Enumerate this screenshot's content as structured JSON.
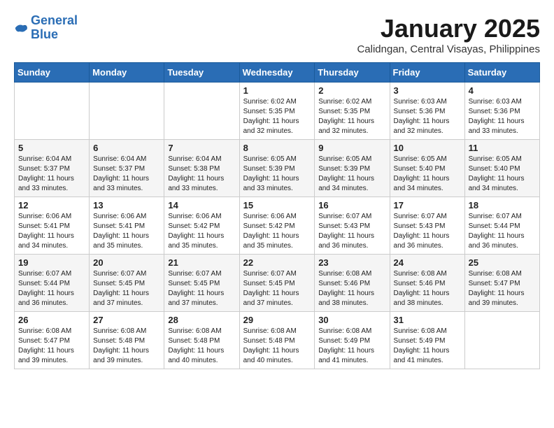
{
  "logo": {
    "line1": "General",
    "line2": "Blue"
  },
  "title": "January 2025",
  "location": "Calidngan, Central Visayas, Philippines",
  "days_of_week": [
    "Sunday",
    "Monday",
    "Tuesday",
    "Wednesday",
    "Thursday",
    "Friday",
    "Saturday"
  ],
  "weeks": [
    [
      {
        "num": "",
        "sunrise": "",
        "sunset": "",
        "daylight": ""
      },
      {
        "num": "",
        "sunrise": "",
        "sunset": "",
        "daylight": ""
      },
      {
        "num": "",
        "sunrise": "",
        "sunset": "",
        "daylight": ""
      },
      {
        "num": "1",
        "sunrise": "Sunrise: 6:02 AM",
        "sunset": "Sunset: 5:35 PM",
        "daylight": "Daylight: 11 hours and 32 minutes."
      },
      {
        "num": "2",
        "sunrise": "Sunrise: 6:02 AM",
        "sunset": "Sunset: 5:35 PM",
        "daylight": "Daylight: 11 hours and 32 minutes."
      },
      {
        "num": "3",
        "sunrise": "Sunrise: 6:03 AM",
        "sunset": "Sunset: 5:36 PM",
        "daylight": "Daylight: 11 hours and 32 minutes."
      },
      {
        "num": "4",
        "sunrise": "Sunrise: 6:03 AM",
        "sunset": "Sunset: 5:36 PM",
        "daylight": "Daylight: 11 hours and 33 minutes."
      }
    ],
    [
      {
        "num": "5",
        "sunrise": "Sunrise: 6:04 AM",
        "sunset": "Sunset: 5:37 PM",
        "daylight": "Daylight: 11 hours and 33 minutes."
      },
      {
        "num": "6",
        "sunrise": "Sunrise: 6:04 AM",
        "sunset": "Sunset: 5:37 PM",
        "daylight": "Daylight: 11 hours and 33 minutes."
      },
      {
        "num": "7",
        "sunrise": "Sunrise: 6:04 AM",
        "sunset": "Sunset: 5:38 PM",
        "daylight": "Daylight: 11 hours and 33 minutes."
      },
      {
        "num": "8",
        "sunrise": "Sunrise: 6:05 AM",
        "sunset": "Sunset: 5:39 PM",
        "daylight": "Daylight: 11 hours and 33 minutes."
      },
      {
        "num": "9",
        "sunrise": "Sunrise: 6:05 AM",
        "sunset": "Sunset: 5:39 PM",
        "daylight": "Daylight: 11 hours and 34 minutes."
      },
      {
        "num": "10",
        "sunrise": "Sunrise: 6:05 AM",
        "sunset": "Sunset: 5:40 PM",
        "daylight": "Daylight: 11 hours and 34 minutes."
      },
      {
        "num": "11",
        "sunrise": "Sunrise: 6:05 AM",
        "sunset": "Sunset: 5:40 PM",
        "daylight": "Daylight: 11 hours and 34 minutes."
      }
    ],
    [
      {
        "num": "12",
        "sunrise": "Sunrise: 6:06 AM",
        "sunset": "Sunset: 5:41 PM",
        "daylight": "Daylight: 11 hours and 34 minutes."
      },
      {
        "num": "13",
        "sunrise": "Sunrise: 6:06 AM",
        "sunset": "Sunset: 5:41 PM",
        "daylight": "Daylight: 11 hours and 35 minutes."
      },
      {
        "num": "14",
        "sunrise": "Sunrise: 6:06 AM",
        "sunset": "Sunset: 5:42 PM",
        "daylight": "Daylight: 11 hours and 35 minutes."
      },
      {
        "num": "15",
        "sunrise": "Sunrise: 6:06 AM",
        "sunset": "Sunset: 5:42 PM",
        "daylight": "Daylight: 11 hours and 35 minutes."
      },
      {
        "num": "16",
        "sunrise": "Sunrise: 6:07 AM",
        "sunset": "Sunset: 5:43 PM",
        "daylight": "Daylight: 11 hours and 36 minutes."
      },
      {
        "num": "17",
        "sunrise": "Sunrise: 6:07 AM",
        "sunset": "Sunset: 5:43 PM",
        "daylight": "Daylight: 11 hours and 36 minutes."
      },
      {
        "num": "18",
        "sunrise": "Sunrise: 6:07 AM",
        "sunset": "Sunset: 5:44 PM",
        "daylight": "Daylight: 11 hours and 36 minutes."
      }
    ],
    [
      {
        "num": "19",
        "sunrise": "Sunrise: 6:07 AM",
        "sunset": "Sunset: 5:44 PM",
        "daylight": "Daylight: 11 hours and 36 minutes."
      },
      {
        "num": "20",
        "sunrise": "Sunrise: 6:07 AM",
        "sunset": "Sunset: 5:45 PM",
        "daylight": "Daylight: 11 hours and 37 minutes."
      },
      {
        "num": "21",
        "sunrise": "Sunrise: 6:07 AM",
        "sunset": "Sunset: 5:45 PM",
        "daylight": "Daylight: 11 hours and 37 minutes."
      },
      {
        "num": "22",
        "sunrise": "Sunrise: 6:07 AM",
        "sunset": "Sunset: 5:45 PM",
        "daylight": "Daylight: 11 hours and 37 minutes."
      },
      {
        "num": "23",
        "sunrise": "Sunrise: 6:08 AM",
        "sunset": "Sunset: 5:46 PM",
        "daylight": "Daylight: 11 hours and 38 minutes."
      },
      {
        "num": "24",
        "sunrise": "Sunrise: 6:08 AM",
        "sunset": "Sunset: 5:46 PM",
        "daylight": "Daylight: 11 hours and 38 minutes."
      },
      {
        "num": "25",
        "sunrise": "Sunrise: 6:08 AM",
        "sunset": "Sunset: 5:47 PM",
        "daylight": "Daylight: 11 hours and 39 minutes."
      }
    ],
    [
      {
        "num": "26",
        "sunrise": "Sunrise: 6:08 AM",
        "sunset": "Sunset: 5:47 PM",
        "daylight": "Daylight: 11 hours and 39 minutes."
      },
      {
        "num": "27",
        "sunrise": "Sunrise: 6:08 AM",
        "sunset": "Sunset: 5:48 PM",
        "daylight": "Daylight: 11 hours and 39 minutes."
      },
      {
        "num": "28",
        "sunrise": "Sunrise: 6:08 AM",
        "sunset": "Sunset: 5:48 PM",
        "daylight": "Daylight: 11 hours and 40 minutes."
      },
      {
        "num": "29",
        "sunrise": "Sunrise: 6:08 AM",
        "sunset": "Sunset: 5:48 PM",
        "daylight": "Daylight: 11 hours and 40 minutes."
      },
      {
        "num": "30",
        "sunrise": "Sunrise: 6:08 AM",
        "sunset": "Sunset: 5:49 PM",
        "daylight": "Daylight: 11 hours and 41 minutes."
      },
      {
        "num": "31",
        "sunrise": "Sunrise: 6:08 AM",
        "sunset": "Sunset: 5:49 PM",
        "daylight": "Daylight: 11 hours and 41 minutes."
      },
      {
        "num": "",
        "sunrise": "",
        "sunset": "",
        "daylight": ""
      }
    ]
  ]
}
